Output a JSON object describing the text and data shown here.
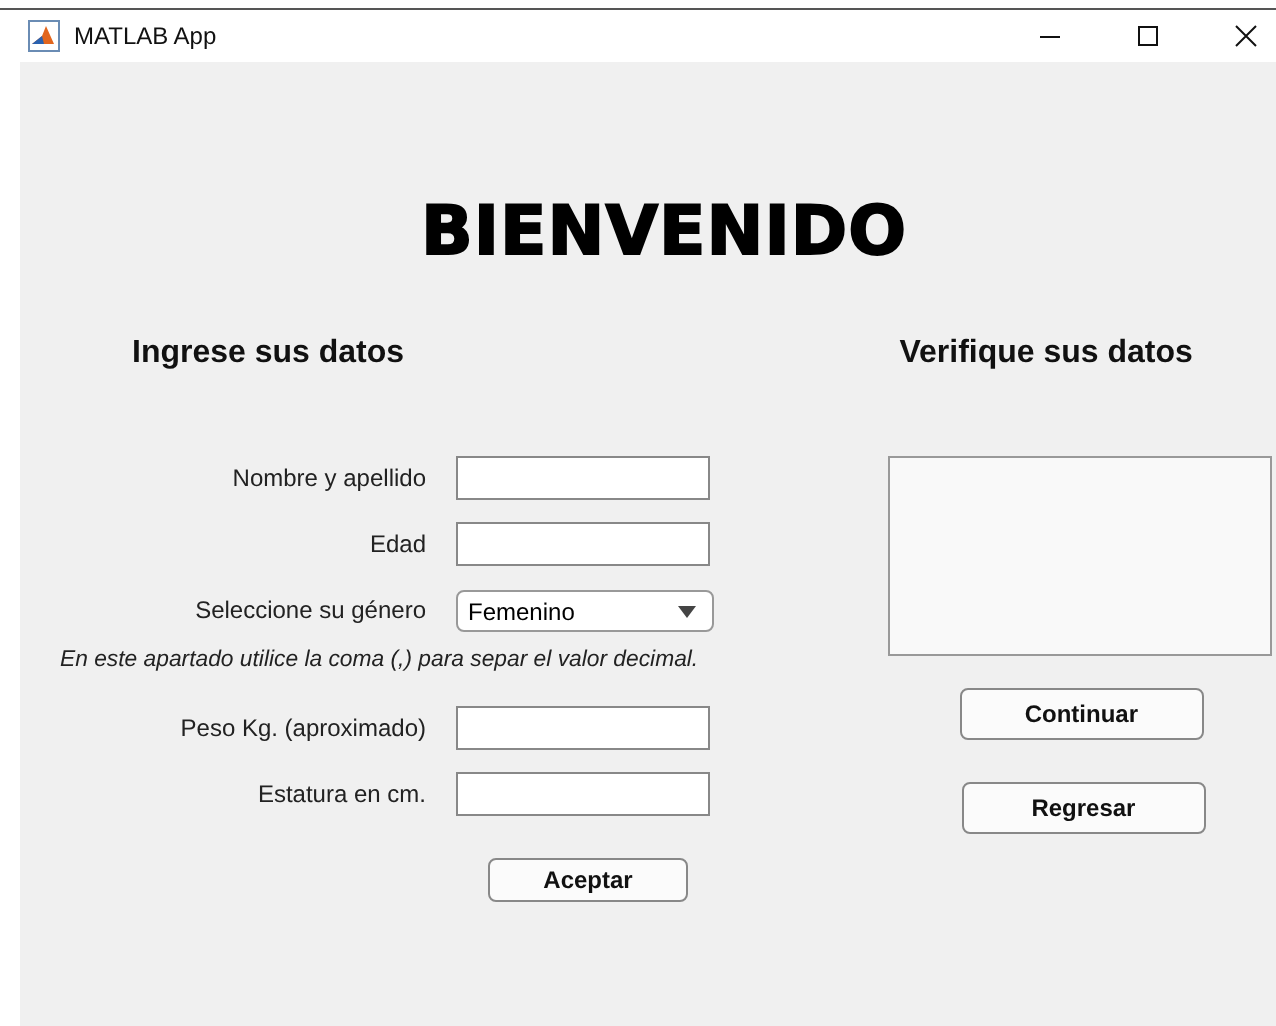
{
  "window": {
    "title": "MATLAB App"
  },
  "heading": "BIENVENIDO",
  "form": {
    "title": "Ingrese sus datos",
    "fields": [
      {
        "kind": "text",
        "label": "Nombre y apellido"
      },
      {
        "kind": "text",
        "label": "Edad"
      },
      {
        "kind": "dropdown",
        "label": "Seleccione su género",
        "value": "Femenino"
      },
      {
        "kind": "note",
        "label": "En este apartado utilice la coma (,) para separ el valor decimal."
      },
      {
        "kind": "text",
        "label": "Peso Kg. (aproximado)"
      },
      {
        "kind": "text",
        "label": "Estatura en cm."
      }
    ],
    "button": "Aceptar"
  },
  "verify": {
    "title": "Verifique sus datos",
    "buttons": [
      "Continuar",
      "Regresar"
    ]
  }
}
